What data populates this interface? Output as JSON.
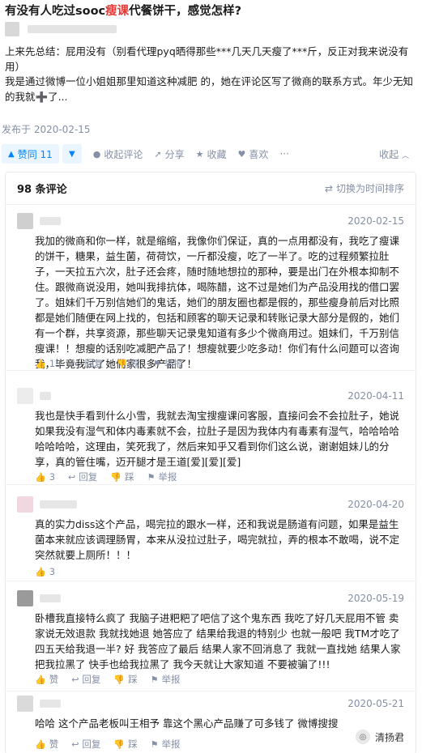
{
  "question": {
    "title_before": "有没有人吃过sooc",
    "title_highlight": "瘦课",
    "title_after": "代餐饼干，感觉怎样?"
  },
  "answer": {
    "para1": "上来先总结：屁用没有（别看代理pyq晒得那些***几天几天瘦了***斤，反正对我来说没有用）",
    "para2": "我是通过微博一位小姐姐那里知道这种减肥 的，她在评论区写了微商的联系方式。年少无知的我就➕了...",
    "date": "发布于 2020-02-15"
  },
  "actions": {
    "upvote": "赞同 11",
    "comment": "收起评论",
    "share": "分享",
    "favorite": "收藏",
    "like": "喜欢",
    "collapse": "收起"
  },
  "comments_header": {
    "count": "98 条评论",
    "sort": "切换为时间排序"
  },
  "comments": [
    {
      "date": "2020-02-15",
      "text": "我加的微商和你一样，就是缩缩，我像你们保证，真的一点用都没有，我吃了瘦课的饼干，糖果，益生菌，荷荷饮，一斤都没瘦，吃了一半了。吃的过程频繁拉肚子，一天拉五六次，肚子还会疼，随时随地想拉的那种，要是出门在外根本抑制不住。跟微商说没用，她叫我排抗体，喝陈醋，这不过是她们为产品没用找的借口罢了。姐妹们千万别信她们的鬼话，她们的朋友圈也都是假的，那些瘦身前后对比照都是她们随便在网上找的，包括和顾客的聊天记录和转账记录大部分是假的，她们有一个群，共享资源，那些聊天记录鬼知道有多少个微商用过。姐妹们，千万别信瘦课！！想瘦的话别吃减肥产品了！想瘦就要少吃多动！你们有什么问题可以咨询我，毕竟我试了她们家很多产品了！",
      "likes": "13",
      "reply": "回复",
      "dislike": "踩",
      "report": "举报"
    },
    {
      "date": "2020-04-11",
      "text": "我也是快手看到什么小雪，我就去淘宝搜瘦课问客服，直接问会不会拉肚子，她说如果我没有湿气和体内毒素就不会，拉肚子是因为我体内有毒素有湿气，哈哈哈哈哈哈哈哈，这理由，笑死我了，然后来知乎又看到你们这么说，谢谢姐妹儿的分享，真的管住嘴，迈开腿才是王道[爱][爱][爱]",
      "likes": "3",
      "reply": "回复",
      "dislike": "踩",
      "report": "举报"
    },
    {
      "date": "2020-04-20",
      "text": "真的实力diss这个产品，喝完拉的跟水一样，还和我说是肠道有问题，如果是益生菌本来就应该调理肠胃，本来从没拉过肚子，喝完就拉，弄的根本不敢喝，说不定突然就要上厕所！！！",
      "likes": "3",
      "reply": "",
      "dislike": "",
      "report": ""
    },
    {
      "date": "2020-05-19",
      "text": "卧槽我直接特么疯了 我脑子进粑粑了吧信了这个鬼东西 我吃了好几天屁用不管 卖家说无效退款 我就找她退 她答应了 结果给我退的特别少 也就一般吧 我TM才吃了四五天给我退一半? 好 我答应了最后 结果人家不回消息了 我就一直找她 结果人家把我拉黑了 快手也给我拉黑了 我今天就让大家知道 不要被骗了!!!",
      "likes": "赞",
      "reply": "回复",
      "dislike": "踩",
      "report": "举报"
    },
    {
      "date": "2020-05-21",
      "text": "哈哈 这个产品老板叫王相予 靠这个黑心产品赚了可多钱了 微博搜搜",
      "likes": "赞",
      "reply": "回复",
      "dislike": "踩",
      "report": "举报"
    }
  ],
  "watermark": "清扬君"
}
